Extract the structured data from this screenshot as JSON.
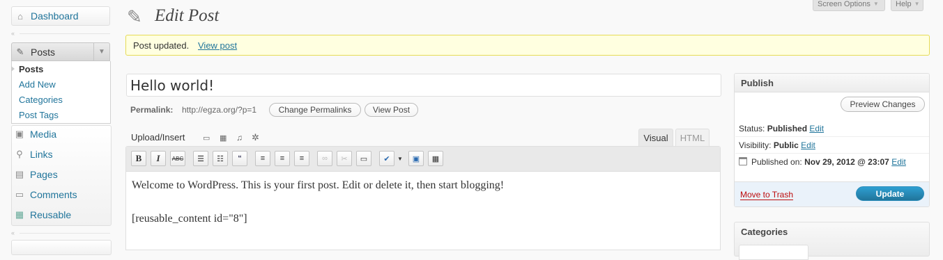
{
  "sidebar": {
    "dashboard": "Dashboard",
    "posts": "Posts",
    "submenu": [
      "Posts",
      "Add New",
      "Categories",
      "Post Tags"
    ],
    "items": [
      {
        "label": "Media",
        "icon": "media-icon"
      },
      {
        "label": "Links",
        "icon": "links-icon"
      },
      {
        "label": "Pages",
        "icon": "pages-icon"
      },
      {
        "label": "Comments",
        "icon": "comments-icon"
      },
      {
        "label": "Reusable",
        "icon": "reusable-icon"
      }
    ]
  },
  "header": {
    "title": "Edit Post",
    "screen_options": "Screen Options",
    "help": "Help"
  },
  "notice": {
    "text": "Post updated.",
    "link": "View post"
  },
  "post": {
    "title": "Hello world!",
    "permalink_label": "Permalink:",
    "permalink_url": "http://egza.org/?p=1",
    "change_permalinks": "Change Permalinks",
    "view_post": "View Post"
  },
  "editor": {
    "upload_insert": "Upload/Insert",
    "tab_visual": "Visual",
    "tab_html": "HTML",
    "line1": "Welcome to WordPress. This is your first post. Edit or delete it, then start blogging!",
    "line2": "[reusable_content id=\"8\"]",
    "toolbar": {
      "bold": "B",
      "italic": "I",
      "strike": "ABC"
    }
  },
  "publish": {
    "heading": "Publish",
    "preview": "Preview Changes",
    "status_label": "Status:",
    "status_value": "Published",
    "visibility_label": "Visibility:",
    "visibility_value": "Public",
    "published_label": "Published on:",
    "published_value": "Nov 29, 2012 @ 23:07",
    "edit": "Edit",
    "trash": "Move to Trash",
    "update": "Update"
  },
  "categories": {
    "heading": "Categories"
  }
}
